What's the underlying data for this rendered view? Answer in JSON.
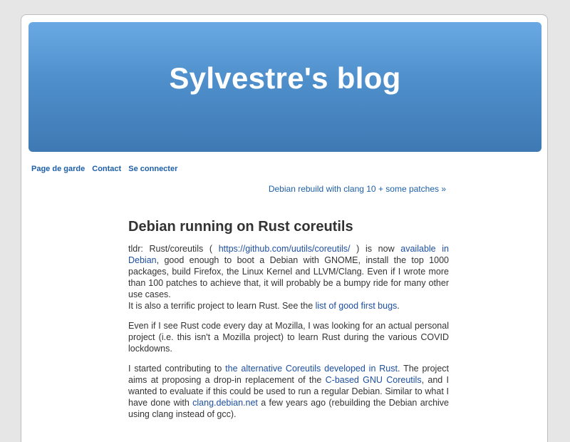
{
  "blog": {
    "title": "Sylvestre's blog"
  },
  "nav": {
    "items": [
      {
        "label": "Page de garde"
      },
      {
        "label": "Contact"
      },
      {
        "label": "Se connecter"
      }
    ]
  },
  "next_post": {
    "label": "Debian rebuild with clang 10 + some patches »"
  },
  "post": {
    "title": "Debian running on Rust coreutils",
    "p1": {
      "t1": "tldr: Rust/coreutils ( ",
      "link1": "https://github.com/uutils/coreutils/",
      "t2": " ) is now ",
      "link2": "available in Debian",
      "t3": ", good enough to boot a Debian with GNOME, install the top 1000 packages, build Firefox, the Linux Kernel and LLVM/Clang. Even if I wrote more than 100 patches to achieve that, it will probably be a bumpy ride for many other use cases.",
      "t4": "It is also a terrific project to learn Rust. See the ",
      "link3": "list of good first bugs",
      "t5": "."
    },
    "p2": {
      "text": "Even if I see Rust code every day at Mozilla, I was looking for an actual personal project (i.e. this isn't a Mozilla project) to learn Rust during the various COVID lockdowns."
    },
    "p3": {
      "t1": "I started contributing to ",
      "link1": "the alternative Coreutils developed in Rust",
      "t2": ". The project aims at proposing a drop-in replacement of the ",
      "link2": "C-based GNU Coreutils",
      "t3": ", and I wanted to evaluate if this could be used to run a regular Debian. Similar to what I have done with ",
      "link3": "clang.debian.net",
      "t4": " a few years ago (rebuilding the Debian archive using clang instead of gcc)."
    }
  }
}
